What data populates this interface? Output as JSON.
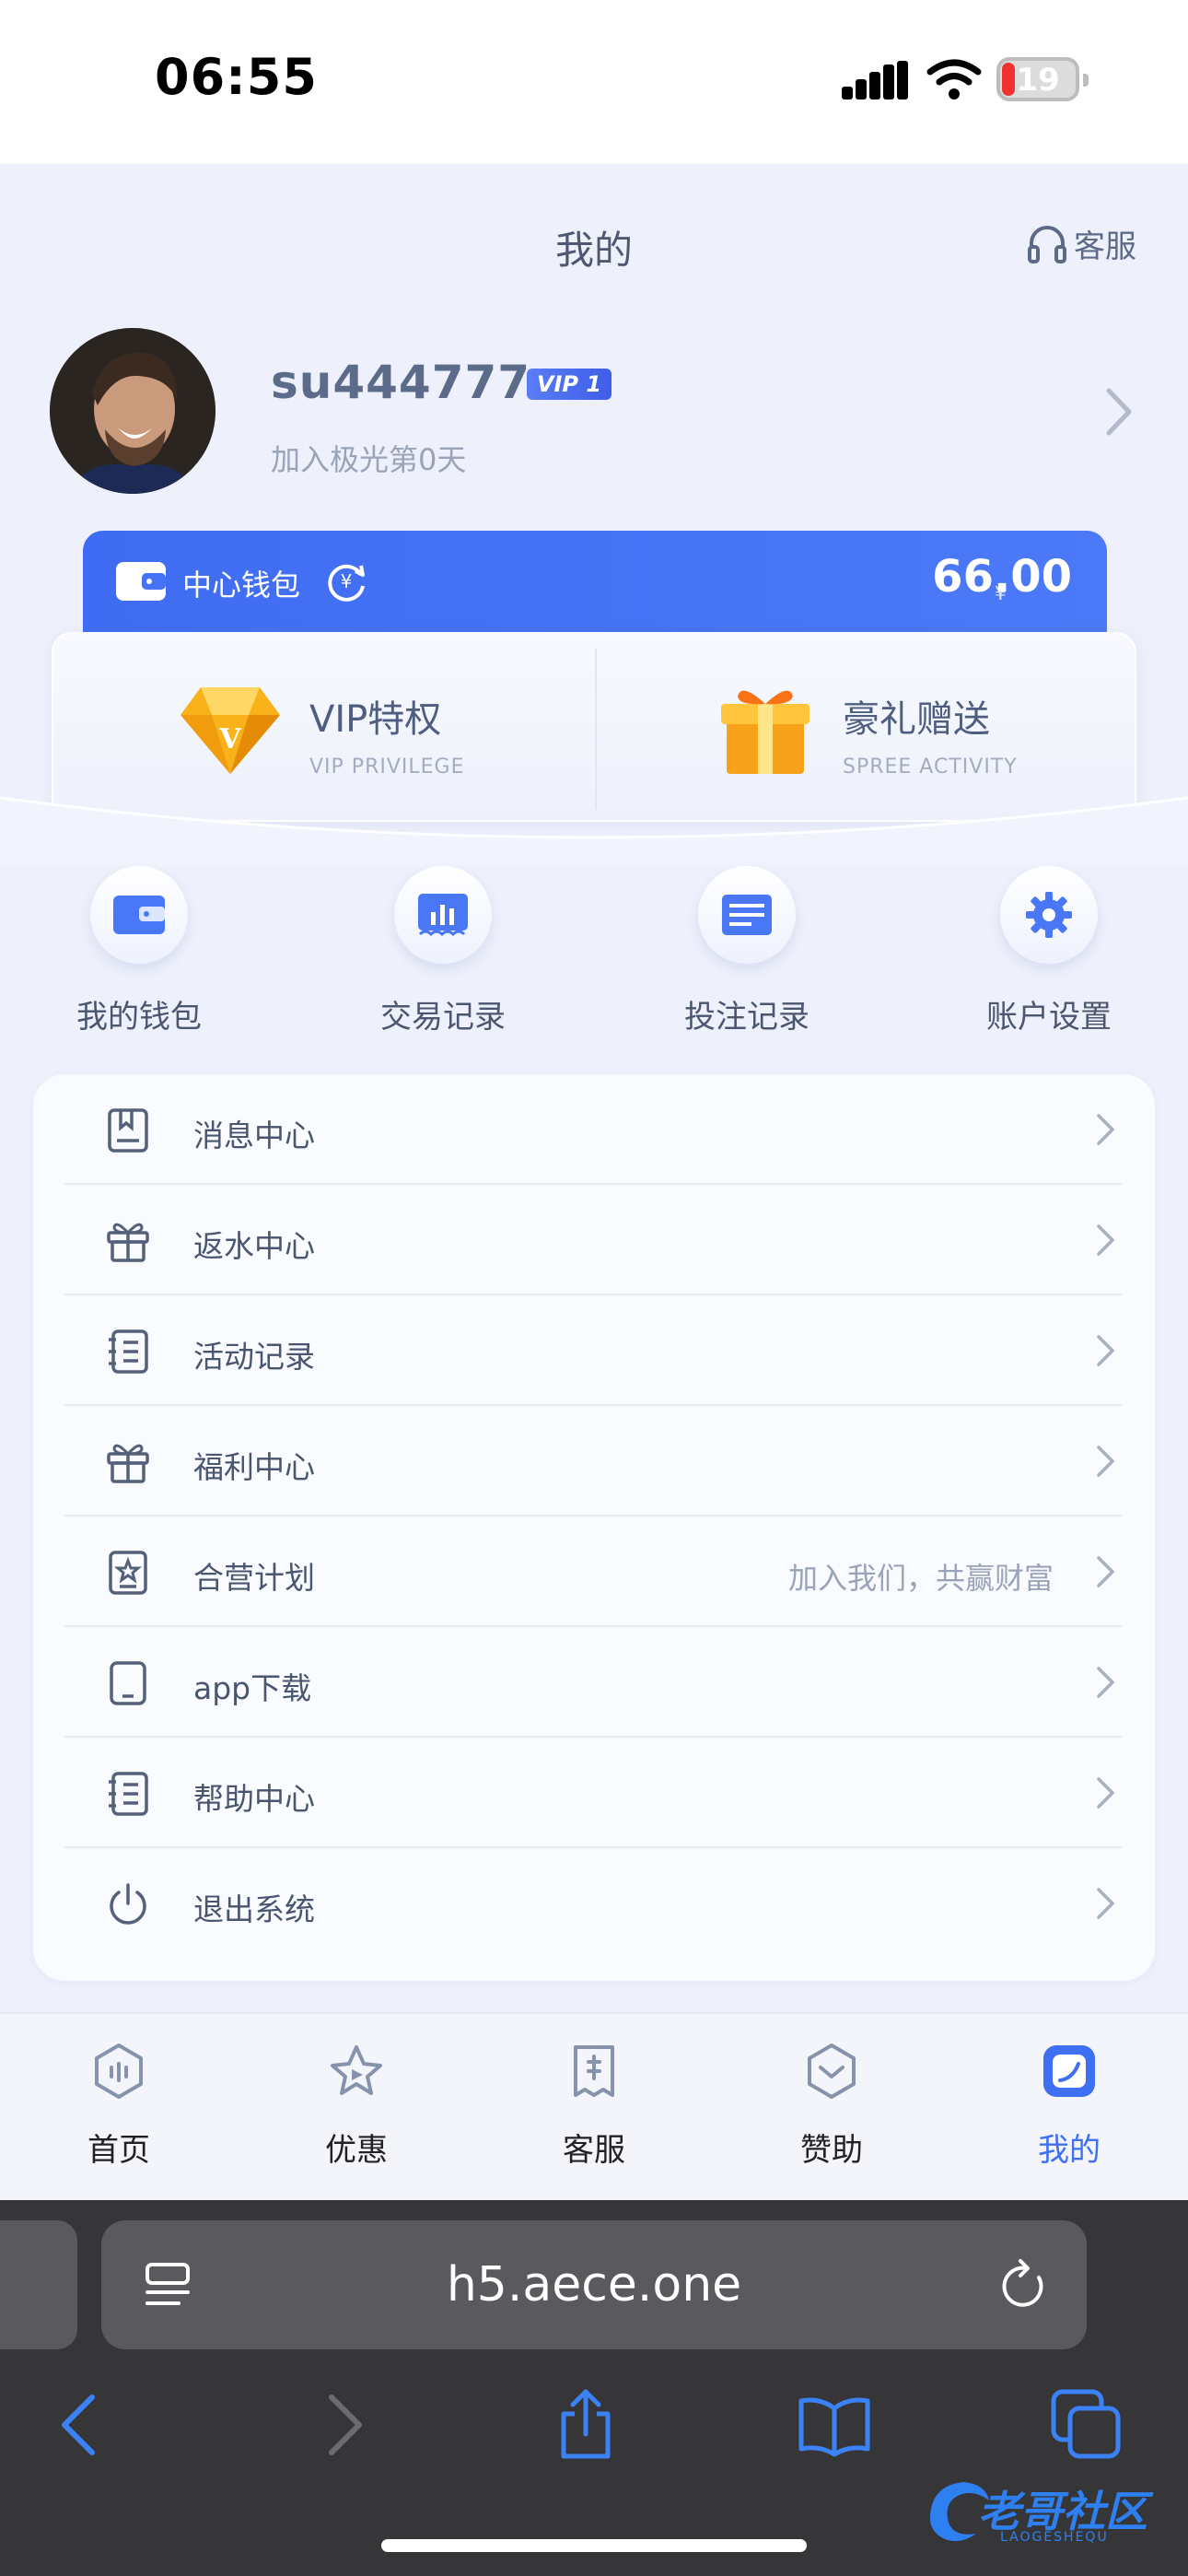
{
  "status_bar": {
    "time": "06:55",
    "battery_level": "19"
  },
  "header": {
    "title": "我的",
    "customer_service_label": "客服"
  },
  "profile": {
    "username": "su444777",
    "vip_badge": "VIP 1",
    "join_text": "加入极光第0天"
  },
  "wallet": {
    "label": "中心钱包",
    "currency_symbol": "¥",
    "amount": "66.00"
  },
  "promos": [
    {
      "title": "VIP特权",
      "subtitle": "VIP PRIVILEGE",
      "icon": "diamond-icon"
    },
    {
      "title": "豪礼赠送",
      "subtitle": "SPREE ACTIVITY",
      "icon": "gift-box-icon"
    }
  ],
  "quick_actions": [
    {
      "label": "我的钱包",
      "icon": "wallet-icon"
    },
    {
      "label": "交易记录",
      "icon": "transaction-chart-icon"
    },
    {
      "label": "投注记录",
      "icon": "bet-record-icon"
    },
    {
      "label": "账户设置",
      "icon": "gear-icon"
    }
  ],
  "menu": [
    {
      "label": "消息中心",
      "icon": "message-icon",
      "extra": ""
    },
    {
      "label": "返水中心",
      "icon": "gift-icon",
      "extra": ""
    },
    {
      "label": "活动记录",
      "icon": "notebook-icon",
      "extra": ""
    },
    {
      "label": "福利中心",
      "icon": "gift-icon",
      "extra": ""
    },
    {
      "label": "合营计划",
      "icon": "star-badge-icon",
      "extra": "加入我们，共赢财富"
    },
    {
      "label": "app下载",
      "icon": "tablet-icon",
      "extra": ""
    },
    {
      "label": "帮助中心",
      "icon": "notebook-icon",
      "extra": ""
    },
    {
      "label": "退出系统",
      "icon": "power-icon",
      "extra": ""
    }
  ],
  "tabbar": {
    "tabs": [
      {
        "label": "首页",
        "icon": "home-icon"
      },
      {
        "label": "优惠",
        "icon": "star-icon"
      },
      {
        "label": "客服",
        "icon": "service-doc-icon"
      },
      {
        "label": "赞助",
        "icon": "sponsor-heart-icon"
      },
      {
        "label": "我的",
        "icon": "profile-icon"
      }
    ],
    "active_tab": "我的"
  },
  "browser": {
    "url": "h5.aece.one"
  },
  "watermark": {
    "text": "老哥社区",
    "sub": "LAOGESHEQU"
  },
  "colors": {
    "accent": "#3f6ff3",
    "wallet_bar": "#4573f4",
    "text_muted": "#9aa3b8"
  }
}
